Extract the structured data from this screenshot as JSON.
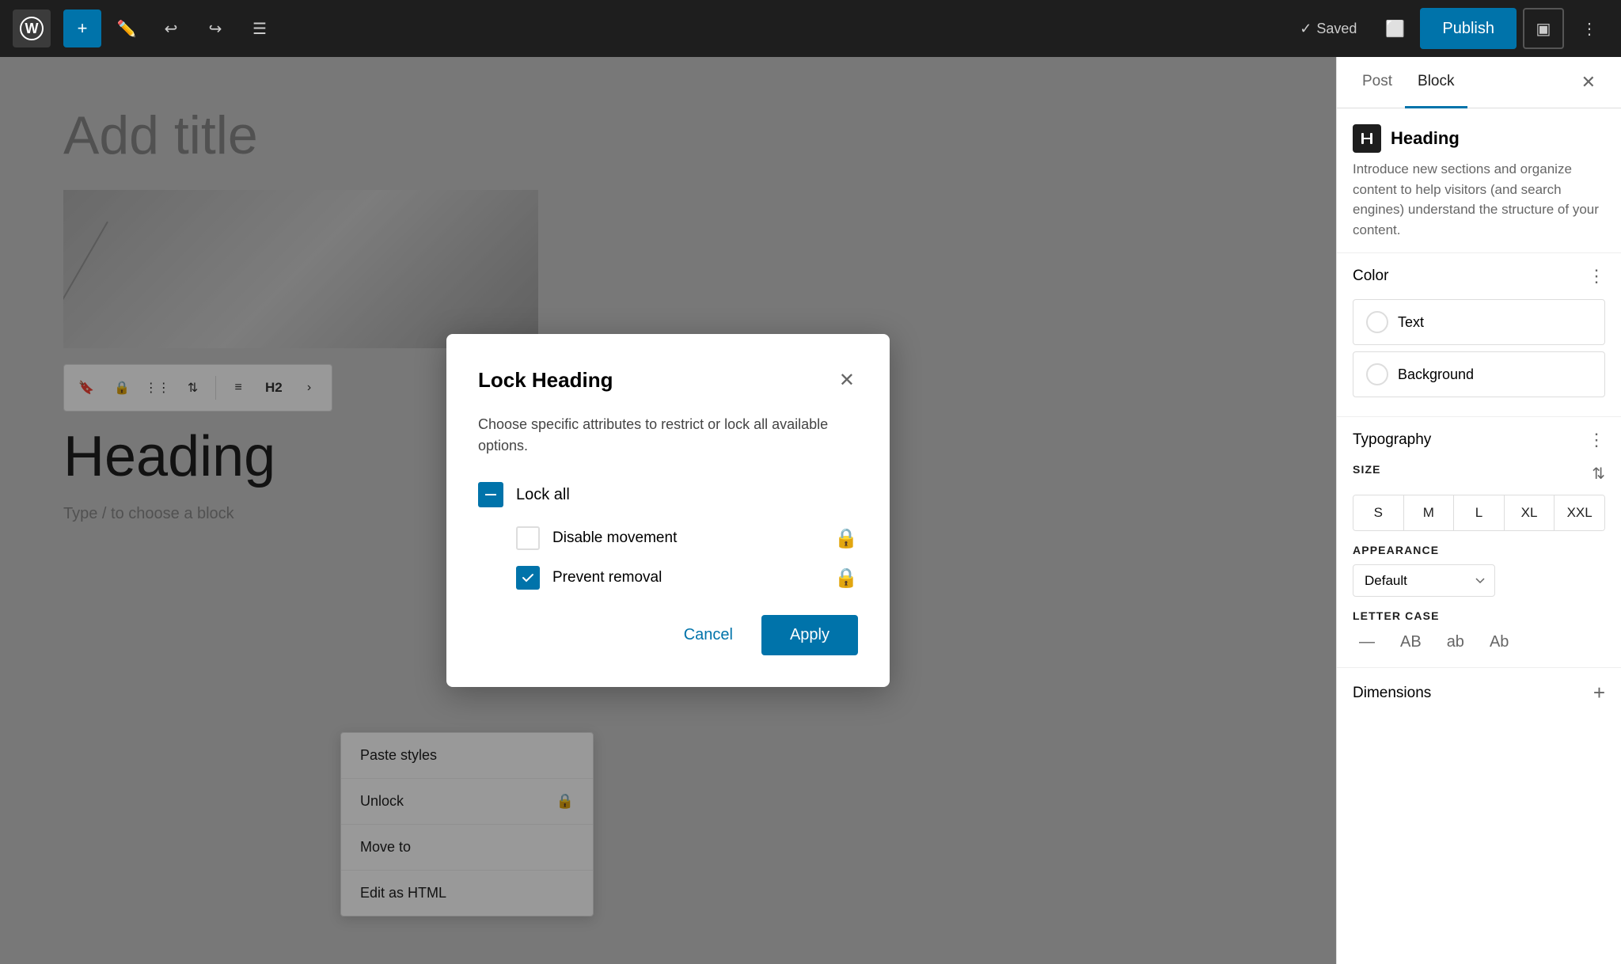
{
  "topbar": {
    "add_label": "+",
    "saved_text": "Saved",
    "publish_label": "Publish",
    "post_tab": "Post",
    "block_tab": "Block"
  },
  "editor": {
    "add_title_placeholder": "Add title",
    "heading_text": "Heading",
    "type_hint": "Type / to choose a block"
  },
  "block_toolbar": {
    "h2_label": "H2"
  },
  "context_menu": {
    "items": [
      {
        "label": "Paste styles",
        "icon": ""
      },
      {
        "label": "Unlock",
        "icon": "🔒"
      },
      {
        "label": "Move to",
        "icon": ""
      },
      {
        "label": "Edit as HTML",
        "icon": ""
      }
    ]
  },
  "sidebar": {
    "block_title": "Heading",
    "block_desc": "Introduce new sections and organize content to help visitors (and search engines) understand the structure of your content.",
    "color_section_title": "Color",
    "text_label": "Text",
    "background_label": "Background",
    "typography_title": "Typography",
    "size_label": "SIZE",
    "size_options": [
      "S",
      "M",
      "L",
      "XL",
      "XXL"
    ],
    "appearance_label": "APPEARANCE",
    "appearance_default": "Default",
    "letter_case_label": "LETTER CASE",
    "letter_case_options": [
      "—",
      "AB",
      "ab",
      "Ab"
    ],
    "dimensions_title": "Dimensions"
  },
  "modal": {
    "title": "Lock Heading",
    "description": "Choose specific attributes to restrict or lock all available options.",
    "lock_all_label": "Lock all",
    "disable_movement_label": "Disable movement",
    "prevent_removal_label": "Prevent removal",
    "cancel_label": "Cancel",
    "apply_label": "Apply",
    "lock_all_checked": true,
    "disable_movement_checked": false,
    "prevent_removal_checked": true
  }
}
